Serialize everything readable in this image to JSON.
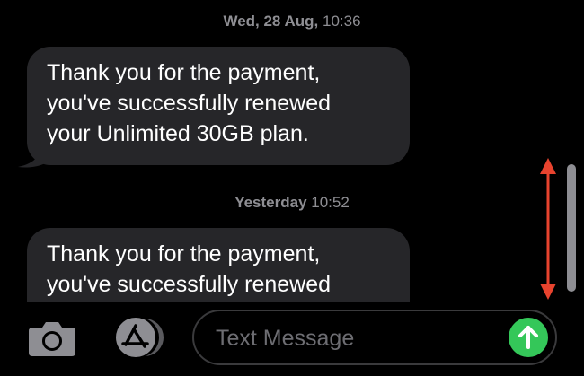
{
  "messages": [
    {
      "date": "Wed, 28 Aug,",
      "time": "10:36",
      "lines": [
        "Thank you for the payment,",
        "you've successfully renewed",
        "your Unlimited 30GB plan."
      ]
    },
    {
      "date": "Yesterday",
      "time": "10:52",
      "lines": [
        "Thank you for the payment,",
        "you've successfully renewed"
      ]
    }
  ],
  "composer": {
    "placeholder": "Text Message"
  },
  "colors": {
    "background": "#000000",
    "bubble": "#262629",
    "send": "#34c759",
    "annotation_arrow": "#e8432e"
  },
  "icons": {
    "camera": "camera-icon",
    "apps": "app-store-icon",
    "send": "send-arrow-icon"
  }
}
